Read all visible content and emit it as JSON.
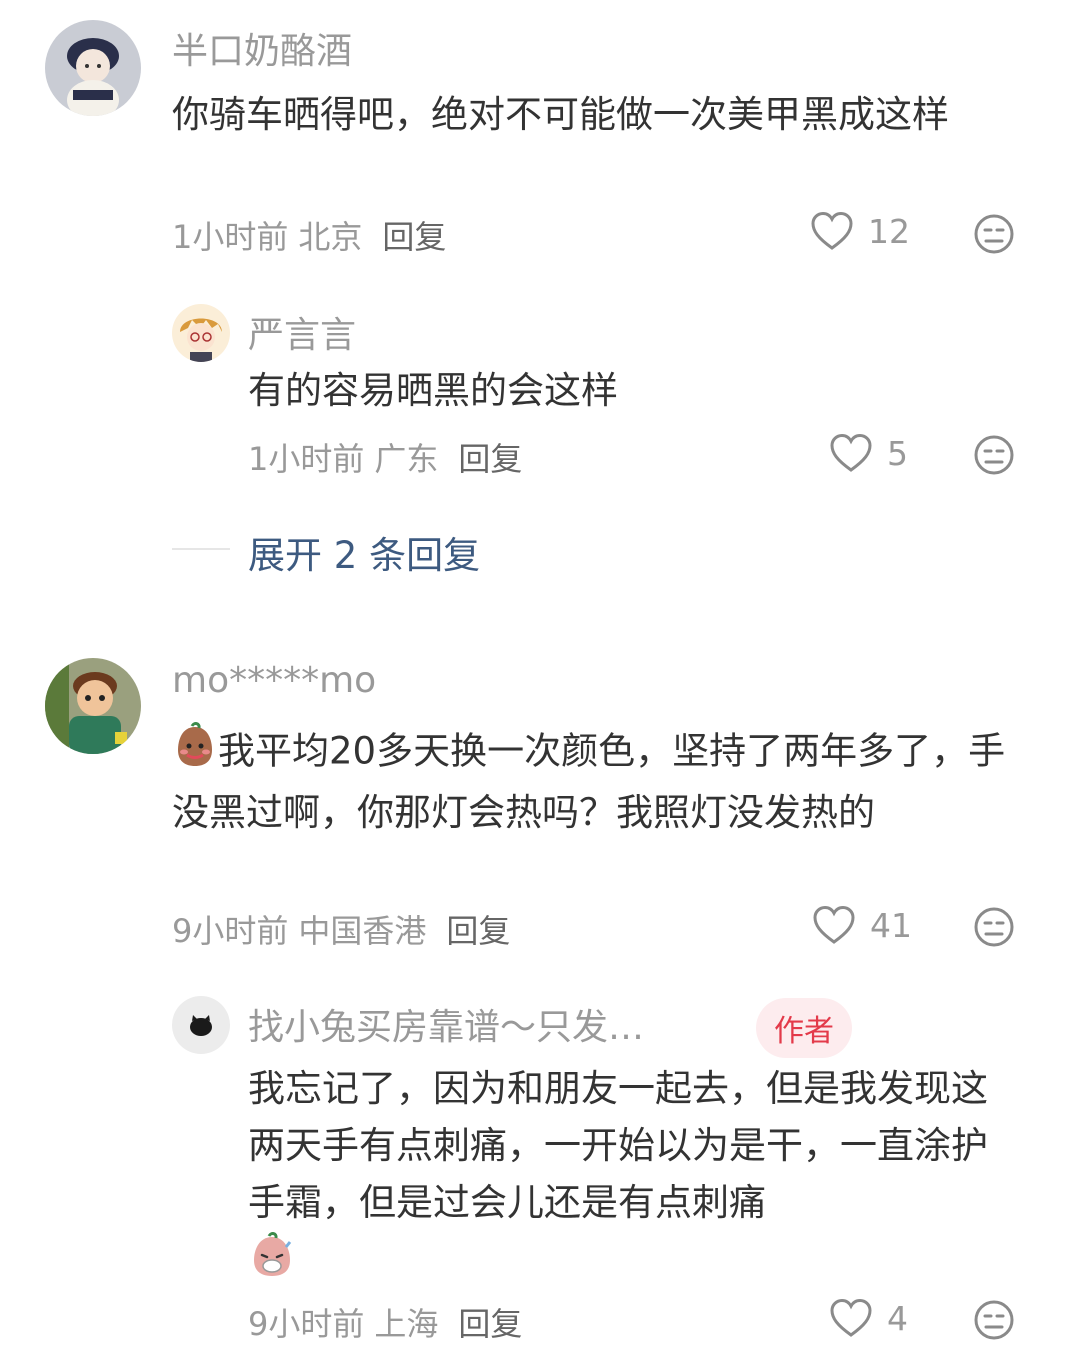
{
  "comments": [
    {
      "user": "半口奶酪酒",
      "text": "你骑车晒得吧，绝对不可能做一次美甲黑成这样",
      "time": "1小时前",
      "location": "北京",
      "reply_label": "回复",
      "likes": "12",
      "replies": [
        {
          "user": "严言言",
          "text": "有的容易晒黑的会这样",
          "time": "1小时前",
          "location": "广东",
          "reply_label": "回复",
          "likes": "5"
        }
      ],
      "expand_label": "展开 2 条回复"
    },
    {
      "user": "mo*****mo",
      "text": "我平均20多天换一次颜色，坚持了两年多了，手没黑过啊，你那灯会热吗？我照灯没发热的",
      "time": "9小时前",
      "location": "中国香港",
      "reply_label": "回复",
      "likes": "41",
      "replies": [
        {
          "user": "找小兔买房靠谱～只发…",
          "badge": "作者",
          "text": "我忘记了，因为和朋友一起去，但是我发现这两天手有点刺痛，一开始以为是干，一直涂护手霜，但是过会儿还是有点刺痛",
          "time": "9小时前",
          "location": "上海",
          "reply_label": "回复",
          "likes": "4"
        }
      ]
    }
  ],
  "icons": {
    "like": "heart-outline-icon",
    "dislike": "neutral-face-icon",
    "emoji_1": "sweat-bean-emoji",
    "emoji_2": "sick-bean-emoji"
  },
  "colors": {
    "text": "#333333",
    "meta": "#999999",
    "link": "#3d5a80",
    "badge_bg": "#fdecee",
    "badge_fg": "#e33a4a"
  }
}
